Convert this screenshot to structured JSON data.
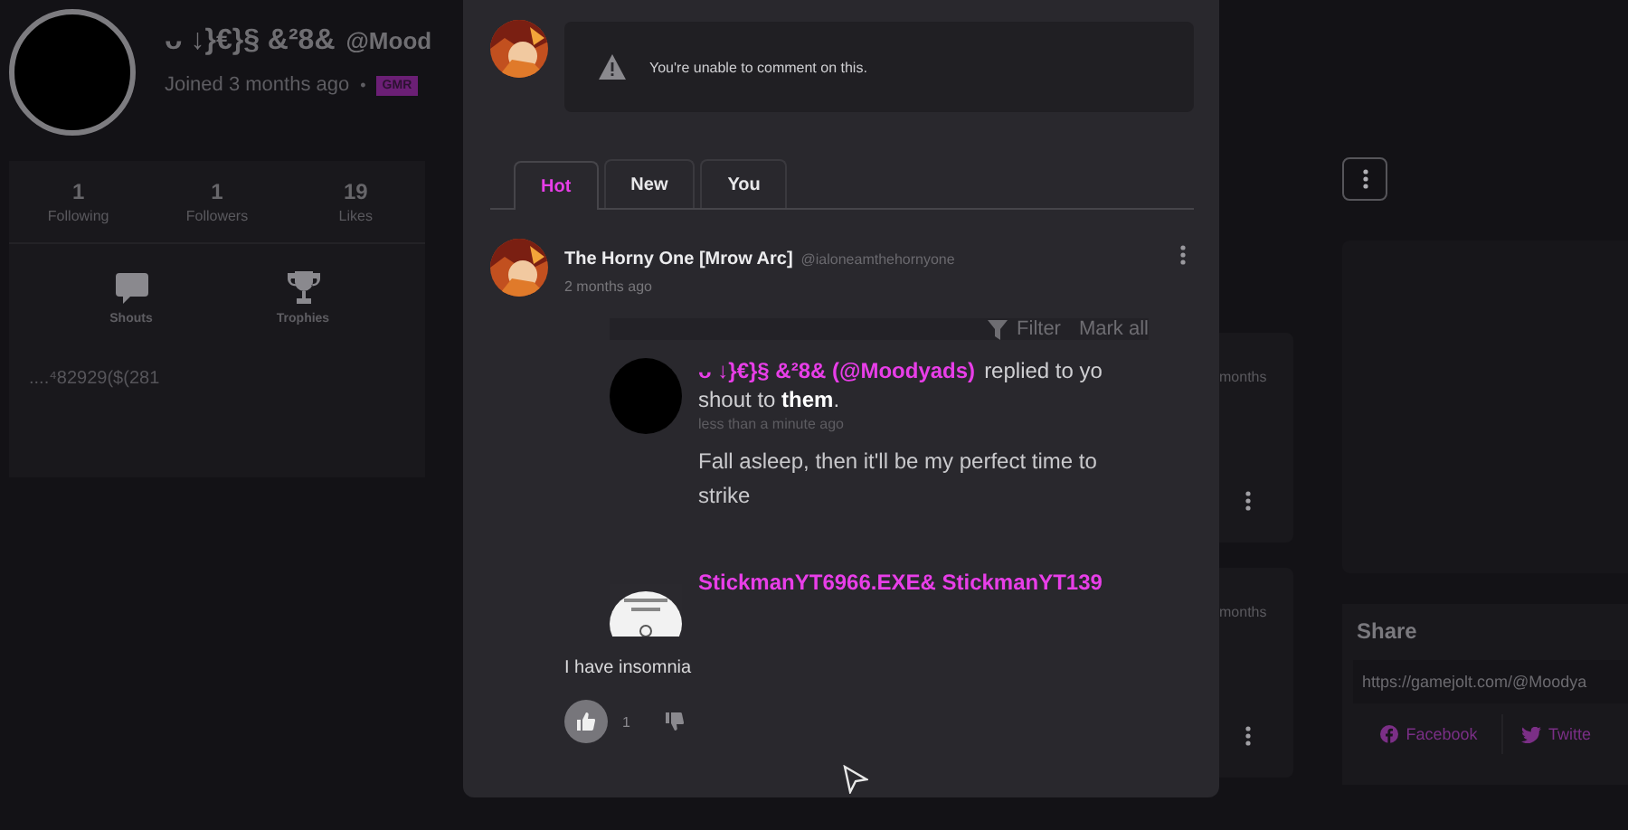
{
  "profile": {
    "display_name": "ᴗ ↓}€}§ &²8&",
    "username": "@Mood",
    "joined": "Joined 3 months ago",
    "badge": "GMR",
    "stats": [
      {
        "value": "1",
        "label": "Following"
      },
      {
        "value": "1",
        "label": "Followers"
      },
      {
        "value": "19",
        "label": "Likes"
      }
    ],
    "separator": "•",
    "nav": [
      {
        "label": "Shouts"
      },
      {
        "label": "Trophies"
      }
    ],
    "bio": "....⁴82929($(281"
  },
  "modal": {
    "comment_notice": "You're unable to comment on this.",
    "tabs": [
      {
        "label": "Hot",
        "selected": true
      },
      {
        "label": "New",
        "selected": false
      },
      {
        "label": "You",
        "selected": false
      }
    ],
    "comment": {
      "author": "The Horny One [Mrow Arc]",
      "username": "@ialoneamthehornyone",
      "time": "2 months ago",
      "screenshot": {
        "toolbar": [
          {
            "label": "Filter"
          },
          {
            "label": "Mark all"
          }
        ],
        "notifications": [
          {
            "kind": "blank",
            "actor": "ᴗ ↓}€}§ &²8& (@Moodyads)",
            "line1": "replied to yo",
            "line2": "shout to **them**.",
            "time": "less than a minute ago",
            "body": "Fall asleep, then it'll be my perfect time to strike"
          },
          {
            "kind": "picture",
            "actor": "StickmanYT6966.EXE& StickmanYT139"
          }
        ]
      },
      "text": "I have insomnia",
      "likes": "1",
      "liked": true
    }
  },
  "background_posts": [
    {
      "time": "months"
    },
    {
      "time": "months"
    }
  ],
  "share": {
    "title": "Share",
    "url": "https://gamejolt.com/@Moodya",
    "links": [
      {
        "label": "Facebook"
      },
      {
        "label": "Twitte"
      }
    ]
  }
}
